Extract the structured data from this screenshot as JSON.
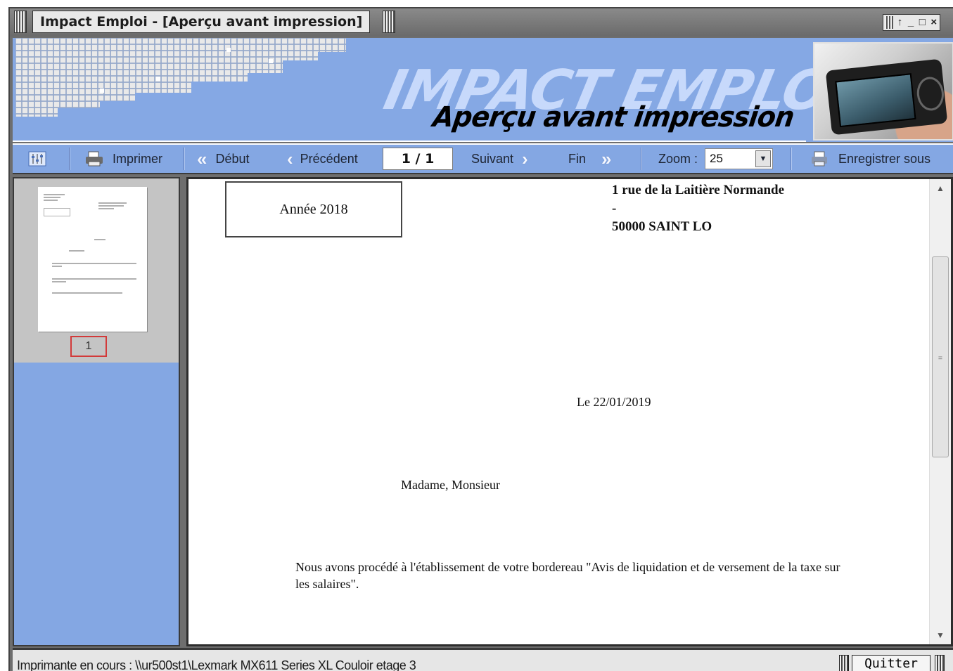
{
  "window": {
    "title": "Impact Emploi - [Aperçu avant impression]",
    "controls": [
      "↑",
      "_",
      "□",
      "×"
    ]
  },
  "banner": {
    "brand": "IMPACT EMPLOI",
    "subtitle": "Aperçu avant impression"
  },
  "toolbar": {
    "settings_icon": "settings-icon",
    "print_label": "Imprimer",
    "first_label": "Début",
    "prev_label": "Précédent",
    "page_indicator": "1 / 1",
    "next_label": "Suivant",
    "last_label": "Fin",
    "zoom_label": "Zoom :",
    "zoom_value": "25",
    "save_as_label": "Enregistrer sous"
  },
  "thumbnails": {
    "current_page": "1"
  },
  "document": {
    "year_box": "Année 2018",
    "address_line1": "1 rue de la Laitière Normande",
    "address_line2": "-",
    "address_line3": "50000 SAINT LO",
    "date": "Le 22/01/2019",
    "salutation": "Madame, Monsieur",
    "body_line1": "Nous avons procédé à l'établissement de votre bordereau \"Avis de liquidation et de versement de la taxe sur",
    "body_line2": "les salaires\"."
  },
  "status": {
    "printer_text": "Imprimante en cours : \\\\ur500st1\\Lexmark MX611 Series XL Couloir etage 3",
    "quit_label": "Quitter"
  },
  "colors": {
    "banner_blue": "#85a8e4",
    "toolbar_blue": "#84a7e3",
    "titlebar_gray": "#6e6e6e",
    "thumb_border_red": "#d23a3a"
  }
}
